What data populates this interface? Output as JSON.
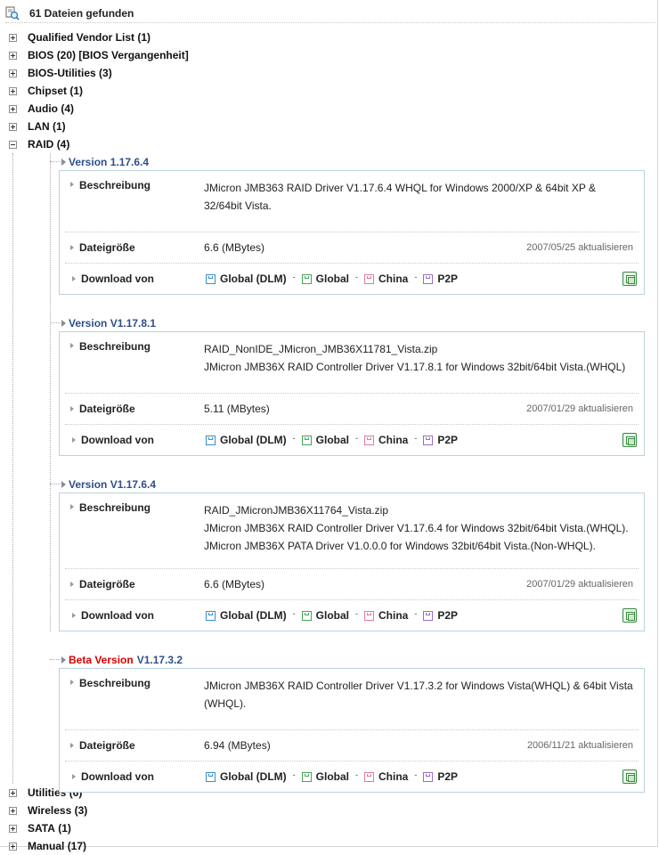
{
  "header": {
    "count_text": "61 Dateien gefunden"
  },
  "categories_top": [
    {
      "label": "Qualified Vendor List",
      "count": "(1)"
    },
    {
      "label": "BIOS",
      "count": "(20)",
      "extra": "[BIOS Vergangenheit]"
    },
    {
      "label": "BIOS-Utilities",
      "count": "(3)"
    },
    {
      "label": "Chipset",
      "count": "(1)"
    },
    {
      "label": "Audio",
      "count": "(4)"
    },
    {
      "label": "LAN",
      "count": "(1)"
    }
  ],
  "raid": {
    "label": "RAID",
    "count": "(4)",
    "labels": {
      "description": "Beschreibung",
      "filesize": "Dateigröße",
      "download": "Download von"
    },
    "links": [
      "Global (DLM)",
      "Global",
      "China",
      "P2P"
    ],
    "versions": [
      {
        "prefix": "",
        "version": "Version 1.17.6.4",
        "desc": [
          "JMicron JMB363 RAID Driver V1.17.6.4 WHQL for Windows 2000/XP & 64bit XP &",
          "32/64bit Vista."
        ],
        "size": "6.6 (MBytes)",
        "date": "2007/05/25 aktualisieren"
      },
      {
        "prefix": "",
        "version": "Version V1.17.8.1",
        "desc": [
          "RAID_NonIDE_JMicron_JMB36X11781_Vista.zip",
          "JMicron JMB36X RAID Controller Driver V1.17.8.1 for Windows 32bit/64bit Vista.(WHQL)"
        ],
        "size": "5.11 (MBytes)",
        "date": "2007/01/29 aktualisieren"
      },
      {
        "prefix": "",
        "version": "Version V1.17.6.4",
        "desc": [
          "RAID_JMicronJMB36X11764_Vista.zip",
          "JMicron JMB36X RAID Controller Driver V1.17.6.4 for Windows 32bit/64bit Vista.(WHQL).",
          "JMicron JMB36X PATA Driver V1.0.0.0 for Windows 32bit/64bit Vista.(Non-WHQL)."
        ],
        "size": "6.6 (MBytes)",
        "date": "2007/01/29 aktualisieren"
      },
      {
        "prefix": "Beta Version",
        "version": "V1.17.3.2",
        "desc": [
          "JMicron JMB36X RAID Controller Driver V1.17.3.2 for Windows Vista(WHQL) & 64bit Vista",
          "(WHQL)."
        ],
        "size": "6.94 (MBytes)",
        "date": "2006/11/21 aktualisieren"
      }
    ]
  },
  "categories_bottom": [
    {
      "label": "Utilities",
      "count": "(6)"
    },
    {
      "label": "Wireless",
      "count": "(3)"
    },
    {
      "label": "SATA",
      "count": "(1)"
    },
    {
      "label": "Manual",
      "count": "(17)"
    }
  ],
  "colors": {
    "version": "#2f4f8a",
    "beta": "#d80000",
    "box_border": "#b9d3dc"
  },
  "icons": {
    "header": "search-files-icon",
    "toggle": "tree-toggle-icon",
    "disk": "floppy-disk-icon",
    "export": "spreadsheet-icon"
  }
}
